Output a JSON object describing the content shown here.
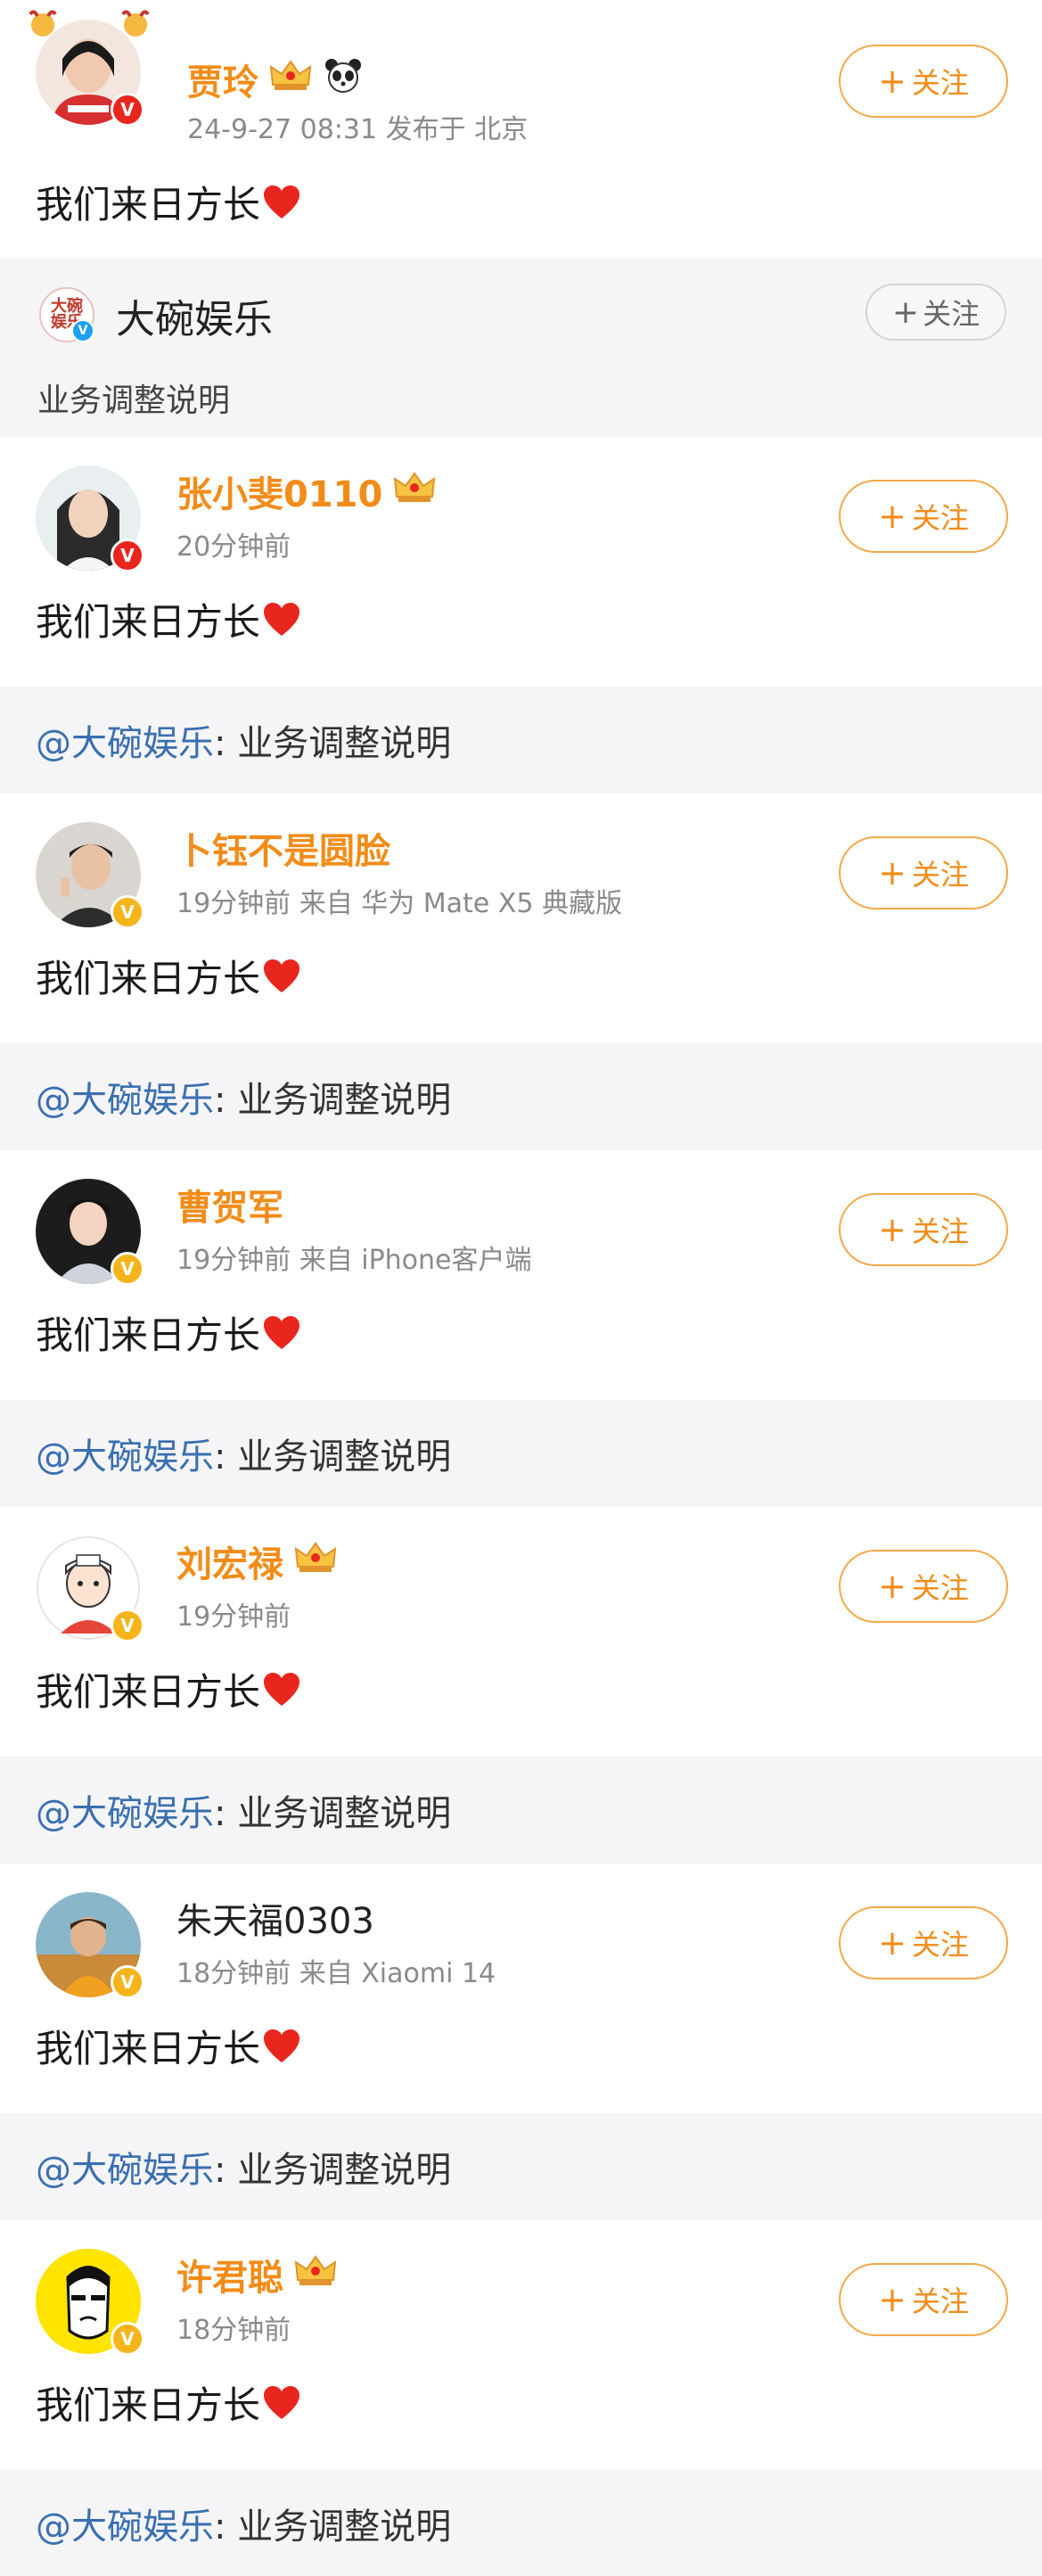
{
  "top_post": {
    "name": "贾玲",
    "meta": "24-9-27 08:31  发布于 北京",
    "follow_label": "关注",
    "content": "我们来日方长"
  },
  "source": {
    "logo_text": "大碗娱乐",
    "name": "大碗娱乐",
    "follow_label": "关注",
    "text": "业务调整说明"
  },
  "reposts": [
    {
      "name": "张小斐0110",
      "meta": "20分钟前",
      "follow_label": "关注",
      "content": "我们来日方长",
      "at": "@大碗娱乐",
      "quote": ": 业务调整说明"
    },
    {
      "name": "卜钰不是圆脸",
      "meta": "19分钟前  来自 华为 Mate X5 典藏版",
      "follow_label": "关注",
      "content": "我们来日方长",
      "at": "@大碗娱乐",
      "quote": ": 业务调整说明"
    },
    {
      "name": "曹贺军",
      "meta": "19分钟前  来自 iPhone客户端",
      "follow_label": "关注",
      "content": "我们来日方长",
      "at": "@大碗娱乐",
      "quote": ": 业务调整说明"
    },
    {
      "name": "刘宏禄",
      "meta": "19分钟前",
      "follow_label": "关注",
      "content": "我们来日方长",
      "at": "@大碗娱乐",
      "quote": ": 业务调整说明"
    },
    {
      "name": "朱天福0303",
      "meta": "18分钟前  来自 Xiaomi 14",
      "follow_label": "关注",
      "content": "我们来日方长",
      "at": "@大碗娱乐",
      "quote": ": 业务调整说明"
    },
    {
      "name": "许君聪",
      "meta": "18分钟前",
      "follow_label": "关注",
      "content": "我们来日方长",
      "at": "@大碗娱乐",
      "quote": ": 业务调整说明"
    }
  ],
  "colors": {
    "name_orange": "#f28c18",
    "follow_border": "#f5a847",
    "mention_blue": "#3a6fb0",
    "section_gray": "#f5f5f7"
  },
  "icons": [
    "verified-red-icon",
    "verified-gold-icon",
    "crown-badge-icon",
    "panda-icon",
    "heart-icon",
    "plus-icon"
  ]
}
